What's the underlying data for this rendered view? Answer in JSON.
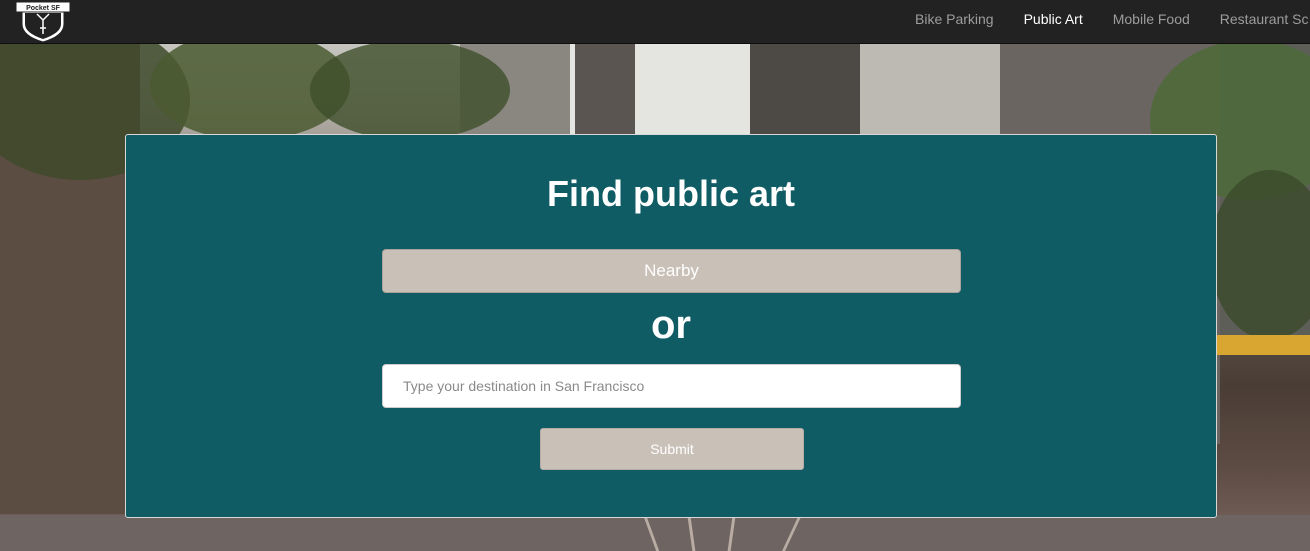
{
  "navbar": {
    "logo_label": "Pocket SF",
    "links": [
      {
        "label": "Bike Parking",
        "active": false
      },
      {
        "label": "Public Art",
        "active": true
      },
      {
        "label": "Mobile Food",
        "active": false
      },
      {
        "label": "Restaurant Sc",
        "active": false
      }
    ]
  },
  "panel": {
    "title": "Find public art",
    "nearby_label": "Nearby",
    "or_label": "or",
    "destination_placeholder": "Type your destination in San Francisco",
    "destination_value": "",
    "submit_label": "Submit"
  },
  "colors": {
    "navbar_bg": "#222222",
    "panel_bg": "#0f5c64",
    "button_bg": "#c9c0b8",
    "active_link": "#ffffff",
    "inactive_link": "#9d9d9d"
  }
}
